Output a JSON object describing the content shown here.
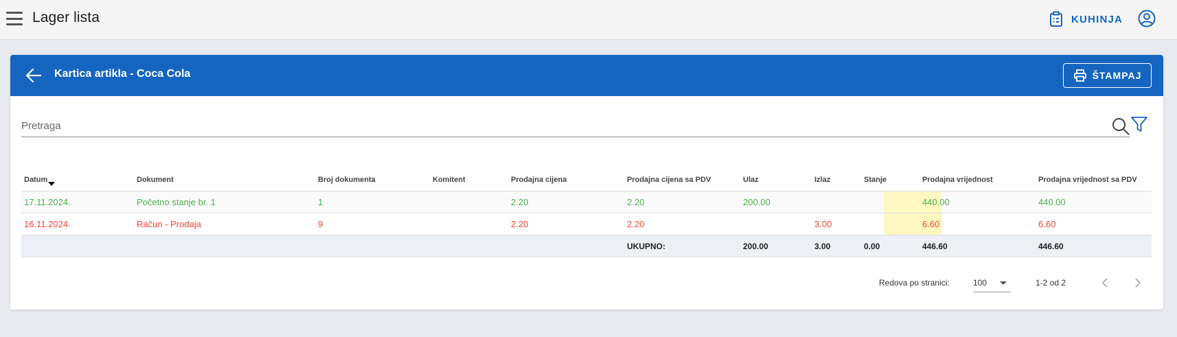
{
  "topbar": {
    "title": "Lager lista",
    "kitchen_label": "KUHINJA"
  },
  "card": {
    "title": "Kartica artikla - Coca Cola",
    "print_label": "ŠTAMPAJ"
  },
  "search": {
    "placeholder": "Pretraga"
  },
  "table": {
    "headers": [
      "Datum",
      "Dokument",
      "Broj dokumenta",
      "Komitent",
      "Prodajna cijena",
      "Prodajna cijena sa PDV",
      "Ulaz",
      "Izlaz",
      "Stanje",
      "Prodajna vrijednost",
      "Prodajna vrijednost sa PDV"
    ],
    "rows": [
      {
        "datum": "17.11.2024.",
        "dokument": "Početno stanje br. 1",
        "broj": "1",
        "komitent": "",
        "cijena": "2.20",
        "cijena_pdv": "2.20",
        "ulaz": "200.00",
        "izlaz": "",
        "stanje": "",
        "vrijednost": "440.00",
        "vrijednost_pdv": "440.00",
        "color": "#4caf50"
      },
      {
        "datum": "16.11.2024.",
        "dokument": "Račun - Prodaja",
        "broj": "9",
        "komitent": "",
        "cijena": "2.20",
        "cijena_pdv": "2.20",
        "ulaz": "",
        "izlaz": "3.00",
        "stanje": "",
        "vrijednost": "6.60",
        "vrijednost_pdv": "6.60",
        "color": "#f44336"
      }
    ],
    "total": {
      "label": "UKUPNO:",
      "ulaz": "200.00",
      "izlaz": "3.00",
      "stanje": "0.00",
      "vrijednost": "446.60",
      "vrijednost_pdv": "446.60"
    }
  },
  "pagination": {
    "rows_label": "Redova po stranici:",
    "rows_value": "100",
    "range": "1-2 od 2"
  },
  "colors": {
    "primary": "#1565c0",
    "positive": "#4caf50",
    "negative": "#f44336",
    "highlight": "#fff7c2"
  }
}
